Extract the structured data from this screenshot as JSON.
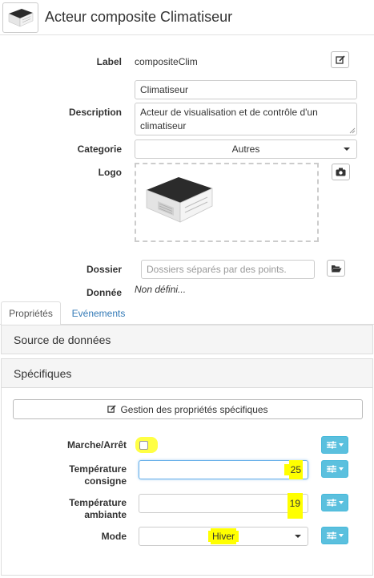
{
  "header": {
    "title": "Acteur composite Climatiseur",
    "logo_icon": "air-conditioner-cassette-icon"
  },
  "form": {
    "label": {
      "caption": "Label",
      "value": "compositeClim"
    },
    "name_value": "Climatiseur",
    "description": {
      "caption": "Description",
      "value": "Acteur de visualisation et de contrôle d'un climatiseur"
    },
    "categorie": {
      "caption": "Categorie",
      "value": "Autres"
    },
    "logo": {
      "caption": "Logo"
    },
    "dossier": {
      "caption": "Dossier",
      "placeholder": "Dossiers séparés par des points."
    },
    "donnee": {
      "caption": "Donnée",
      "value": "Non défini..."
    }
  },
  "tabs": [
    {
      "label": "Propriétés",
      "active": true
    },
    {
      "label": "Evénements",
      "active": false
    }
  ],
  "panels": {
    "source": "Source de données",
    "specifiques": "Spécifiques"
  },
  "gestion_button": "Gestion des propriétés spécifiques",
  "properties": [
    {
      "label": "Marche/Arrêt",
      "type": "checkbox",
      "checked": false
    },
    {
      "label_line1": "Température",
      "label_line2": "consigne",
      "type": "input",
      "value": "25"
    },
    {
      "label_line1": "Température",
      "label_line2": "ambiante",
      "type": "input",
      "value": "19"
    },
    {
      "label": "Mode",
      "type": "select",
      "value": "Hiver"
    }
  ],
  "colors": {
    "accent_blue": "#5bc0de",
    "link_blue": "#337ab7",
    "highlight": "#ffff00"
  }
}
